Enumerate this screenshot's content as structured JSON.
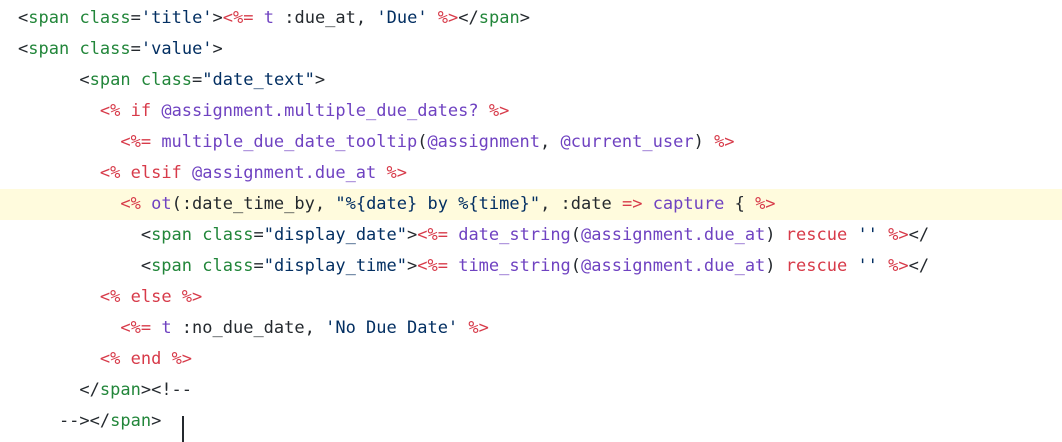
{
  "editor": {
    "colors": {
      "tag": "#22863a",
      "erb": "#d73a49",
      "string": "#032f62",
      "text": "#24292e",
      "ivar": "#6f42c1",
      "symbol": "#005cc5",
      "highlight": "#fffbdd"
    },
    "lines": [
      {
        "tokens": [
          {
            "t": "<",
            "k": "text"
          },
          {
            "t": "span",
            "k": "tag"
          },
          {
            "t": " ",
            "k": "text"
          },
          {
            "t": "class",
            "k": "tag"
          },
          {
            "t": "=",
            "k": "text"
          },
          {
            "t": "'title'",
            "k": "string"
          },
          {
            "t": ">",
            "k": "text"
          },
          {
            "t": "<%=",
            "k": "erb"
          },
          {
            "t": " t ",
            "k": "ivar"
          },
          {
            "t": ":due_at",
            "k": "text"
          },
          {
            "t": ", ",
            "k": "text"
          },
          {
            "t": "'Due'",
            "k": "string"
          },
          {
            "t": " %>",
            "k": "erb"
          },
          {
            "t": "</",
            "k": "text"
          },
          {
            "t": "span",
            "k": "tag"
          },
          {
            "t": ">",
            "k": "text"
          }
        ]
      },
      {
        "tokens": [
          {
            "t": "<",
            "k": "text"
          },
          {
            "t": "span",
            "k": "tag"
          },
          {
            "t": " ",
            "k": "text"
          },
          {
            "t": "class",
            "k": "tag"
          },
          {
            "t": "=",
            "k": "text"
          },
          {
            "t": "'value'",
            "k": "string"
          },
          {
            "t": ">",
            "k": "text"
          }
        ]
      },
      {
        "tokens": [
          {
            "t": "      <",
            "k": "text"
          },
          {
            "t": "span",
            "k": "tag"
          },
          {
            "t": " ",
            "k": "text"
          },
          {
            "t": "class",
            "k": "tag"
          },
          {
            "t": "=",
            "k": "text"
          },
          {
            "t": "\"date_text\"",
            "k": "string"
          },
          {
            "t": ">",
            "k": "text"
          }
        ]
      },
      {
        "tokens": [
          {
            "t": "        ",
            "k": "text"
          },
          {
            "t": "<%",
            "k": "erb"
          },
          {
            "t": " if ",
            "k": "erb"
          },
          {
            "t": "@assignment",
            "k": "ivar"
          },
          {
            "t": ".multiple_due_dates?",
            "k": "ivar"
          },
          {
            "t": " %>",
            "k": "erb"
          }
        ]
      },
      {
        "tokens": [
          {
            "t": "          ",
            "k": "text"
          },
          {
            "t": "<%=",
            "k": "erb"
          },
          {
            "t": " multiple_due_date_tooltip",
            "k": "ivar"
          },
          {
            "t": "(",
            "k": "text"
          },
          {
            "t": "@assignment",
            "k": "ivar"
          },
          {
            "t": ", ",
            "k": "text"
          },
          {
            "t": "@current_user",
            "k": "ivar"
          },
          {
            "t": ")",
            "k": "text"
          },
          {
            "t": " %>",
            "k": "erb"
          }
        ]
      },
      {
        "tokens": [
          {
            "t": "        ",
            "k": "text"
          },
          {
            "t": "<%",
            "k": "erb"
          },
          {
            "t": " elsif ",
            "k": "erb"
          },
          {
            "t": "@assignment",
            "k": "ivar"
          },
          {
            "t": ".due_at",
            "k": "ivar"
          },
          {
            "t": " %>",
            "k": "erb"
          }
        ]
      },
      {
        "highlight": true,
        "tokens": [
          {
            "t": "          ",
            "k": "text"
          },
          {
            "t": "<%",
            "k": "erb"
          },
          {
            "t": " ot",
            "k": "ivar"
          },
          {
            "t": "(",
            "k": "text"
          },
          {
            "t": ":date_time_by",
            "k": "text"
          },
          {
            "t": ", ",
            "k": "text"
          },
          {
            "t": "\"%{date} by %{time}\"",
            "k": "string"
          },
          {
            "t": ", ",
            "k": "text"
          },
          {
            "t": ":date",
            "k": "text"
          },
          {
            "t": " => ",
            "k": "erb"
          },
          {
            "t": "capture",
            "k": "ivar"
          },
          {
            "t": " { ",
            "k": "text"
          },
          {
            "t": "%>",
            "k": "erb"
          }
        ]
      },
      {
        "tokens": [
          {
            "t": "            <",
            "k": "text"
          },
          {
            "t": "span",
            "k": "tag"
          },
          {
            "t": " ",
            "k": "text"
          },
          {
            "t": "class",
            "k": "tag"
          },
          {
            "t": "=",
            "k": "text"
          },
          {
            "t": "\"display_date\"",
            "k": "string"
          },
          {
            "t": ">",
            "k": "text"
          },
          {
            "t": "<%=",
            "k": "erb"
          },
          {
            "t": " date_string",
            "k": "ivar"
          },
          {
            "t": "(",
            "k": "text"
          },
          {
            "t": "@assignment",
            "k": "ivar"
          },
          {
            "t": ".due_at",
            "k": "ivar"
          },
          {
            "t": ")",
            "k": "text"
          },
          {
            "t": " rescue ",
            "k": "erb"
          },
          {
            "t": "''",
            "k": "string"
          },
          {
            "t": " %>",
            "k": "erb"
          },
          {
            "t": "</",
            "k": "text"
          }
        ]
      },
      {
        "tokens": [
          {
            "t": "            <",
            "k": "text"
          },
          {
            "t": "span",
            "k": "tag"
          },
          {
            "t": " ",
            "k": "text"
          },
          {
            "t": "class",
            "k": "tag"
          },
          {
            "t": "=",
            "k": "text"
          },
          {
            "t": "\"display_time\"",
            "k": "string"
          },
          {
            "t": ">",
            "k": "text"
          },
          {
            "t": "<%=",
            "k": "erb"
          },
          {
            "t": " time_string",
            "k": "ivar"
          },
          {
            "t": "(",
            "k": "text"
          },
          {
            "t": "@assignment",
            "k": "ivar"
          },
          {
            "t": ".due_at",
            "k": "ivar"
          },
          {
            "t": ")",
            "k": "text"
          },
          {
            "t": " rescue ",
            "k": "erb"
          },
          {
            "t": "''",
            "k": "string"
          },
          {
            "t": " %>",
            "k": "erb"
          },
          {
            "t": "</",
            "k": "text"
          }
        ]
      },
      {
        "tokens": [
          {
            "t": "        ",
            "k": "text"
          },
          {
            "t": "<%",
            "k": "erb"
          },
          {
            "t": " else ",
            "k": "erb"
          },
          {
            "t": "%>",
            "k": "erb"
          }
        ]
      },
      {
        "tokens": [
          {
            "t": "          ",
            "k": "text"
          },
          {
            "t": "<%=",
            "k": "erb"
          },
          {
            "t": " t ",
            "k": "ivar"
          },
          {
            "t": ":no_due_date",
            "k": "text"
          },
          {
            "t": ", ",
            "k": "text"
          },
          {
            "t": "'No Due Date'",
            "k": "string"
          },
          {
            "t": " %>",
            "k": "erb"
          }
        ]
      },
      {
        "tokens": [
          {
            "t": "        ",
            "k": "text"
          },
          {
            "t": "<%",
            "k": "erb"
          },
          {
            "t": " end ",
            "k": "erb"
          },
          {
            "t": "%>",
            "k": "erb"
          }
        ]
      },
      {
        "tokens": [
          {
            "t": "      </",
            "k": "text"
          },
          {
            "t": "span",
            "k": "tag"
          },
          {
            "t": "><!--",
            "k": "text"
          }
        ]
      },
      {
        "tokens": [
          {
            "t": "    --></",
            "k": "text"
          },
          {
            "t": "span",
            "k": "tag"
          },
          {
            "t": ">",
            "k": "text"
          }
        ]
      }
    ]
  }
}
